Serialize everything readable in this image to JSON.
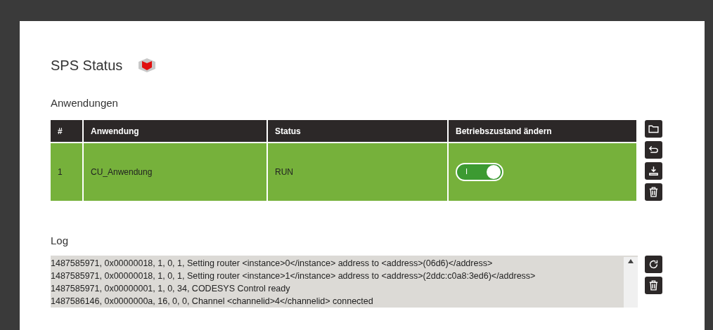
{
  "title": "SPS Status",
  "applications": {
    "heading": "Anwendungen",
    "columns": [
      "#",
      "Anwendung",
      "Status",
      "Betriebszustand ändern"
    ],
    "rows": [
      {
        "index": "1",
        "name": "CU_Anwendung",
        "status": "RUN",
        "toggle": {
          "label": "I",
          "on": true
        }
      }
    ]
  },
  "log": {
    "heading": "Log",
    "lines": [
      "1487585971, 0x00000018, 1, 0, 1, Setting router <instance>0</instance> address to <address>(06d6)</address>",
      "1487585971, 0x00000018, 1, 0, 1, Setting router <instance>1</instance> address to <address>(2ddc:c0a8:3ed6)</address>",
      "1487585971, 0x00000001, 1, 0, 34, CODESYS Control ready",
      "1487586146, 0x0000000a, 16, 0, 0, Channel <channelid>4</channelid> connected"
    ]
  }
}
